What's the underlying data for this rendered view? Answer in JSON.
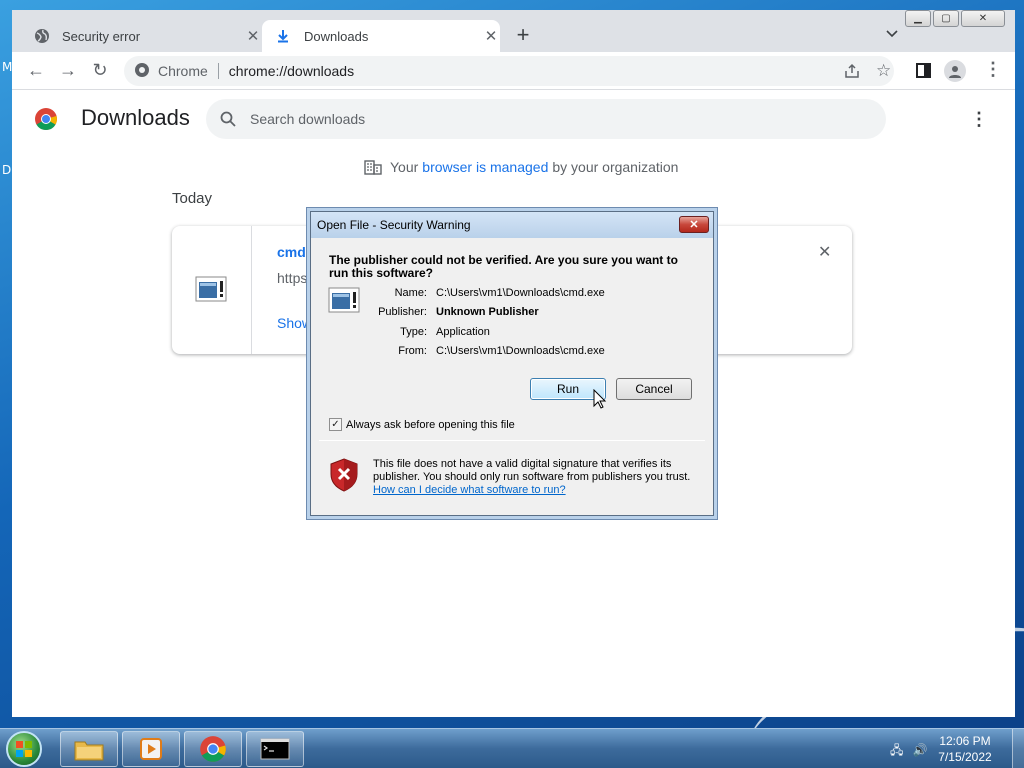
{
  "desktop": {
    "fragment_top": "M",
    "fragment_mid": "D"
  },
  "browser": {
    "tabs": [
      {
        "title": "Security error",
        "icon": "globe-icon"
      },
      {
        "title": "Downloads",
        "icon": "download-icon"
      }
    ],
    "new_tab": "+",
    "omnibox": {
      "site_label": "Chrome",
      "url": "chrome://downloads"
    }
  },
  "downloads_page": {
    "title": "Downloads",
    "search_placeholder": "Search downloads",
    "managed_prefix": "Your",
    "managed_link": "browser is managed",
    "managed_suffix": "by your organization",
    "section_label": "Today",
    "item": {
      "file_name": "cmd.e",
      "url": "https:",
      "action": "Show"
    }
  },
  "dialog": {
    "title": "Open File - Security Warning",
    "close": "✕",
    "heading": "The publisher could not be verified.  Are you sure you want to run this software?",
    "fields": [
      {
        "label": "Name:",
        "value": "C:\\Users\\vm1\\Downloads\\cmd.exe"
      },
      {
        "label": "Publisher:",
        "value": "Unknown Publisher"
      },
      {
        "label": "Type:",
        "value": "Application"
      },
      {
        "label": "From:",
        "value": "C:\\Users\\vm1\\Downloads\\cmd.exe"
      }
    ],
    "run_label": "Run",
    "cancel_label": "Cancel",
    "checkbox_label": "Always ask before opening this file",
    "checkbox_checked": true,
    "warning_text": "This file does not have a valid digital signature that verifies its publisher.  You should only run software from publishers you trust.",
    "warning_link": "How can I decide what software to run?"
  },
  "taskbar": {
    "time": "12:06 PM",
    "date": "7/15/2022",
    "pinned": [
      "file-explorer-icon",
      "media-player-icon",
      "chrome-icon",
      "cmd-icon"
    ]
  },
  "colors": {
    "accent": "#1a73e8",
    "tab_strip": "#dee1e6",
    "dialog_bg": "#f0f0f0"
  }
}
